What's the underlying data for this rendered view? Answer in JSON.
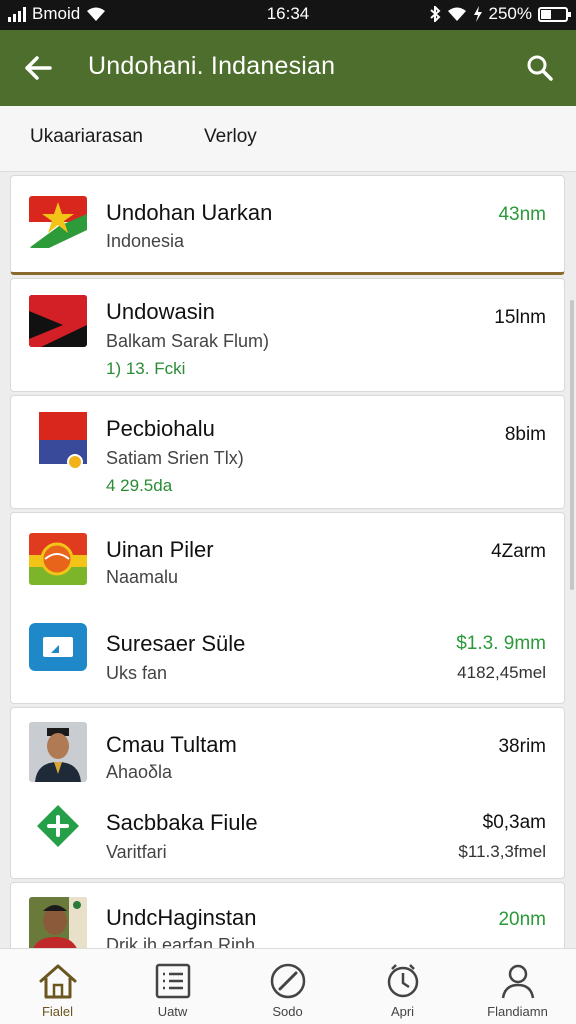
{
  "status_bar": {
    "carrier": "Bmoid",
    "time": "16:34",
    "battery": "250%"
  },
  "app_bar": {
    "title": "Undohani. Indanesian",
    "back_icon": "arrow-left-icon",
    "search_icon": "search-icon"
  },
  "tabs": [
    {
      "label": "Ukaariarasan"
    },
    {
      "label": "Verloy"
    }
  ],
  "items": [
    {
      "name": "Undohan Uarkan",
      "subtitle": "Indonesia",
      "value": "43nm",
      "icon": "flag-icon"
    },
    {
      "name": "Undowasin",
      "subtitle": "Balkam Sarak Flum)",
      "detail": "1) 13. Fcki",
      "value": "15lnm",
      "icon": "flag-icon"
    },
    {
      "name": "Pecbiohalu",
      "subtitle": "Satiam Srien Tlx)",
      "detail": "4 29.5da",
      "value": "8bim",
      "icon": "flag-icon"
    },
    {
      "name": "Uinan Piler",
      "subtitle": "Naamalu",
      "value": "4Zarm",
      "icon": "flag-icon"
    },
    {
      "name": "Suresaer Süle",
      "subtitle": "Uks fan",
      "value": "$1.3. 9mm",
      "value2": "4182,45mel",
      "icon": "chat-icon"
    },
    {
      "name": "Cmau Tultam",
      "subtitle": "Ahaoδla",
      "value": "38rim",
      "icon": "avatar-icon"
    },
    {
      "name": "Sacbbaka Fiule",
      "subtitle": "Varitfari",
      "value": "$0,3am",
      "value2": "$11.3,3fmel",
      "icon": "plus-icon"
    },
    {
      "name": "UndcHaginstan",
      "subtitle": "Drik ih earfan Rinh",
      "value": "20nm",
      "icon": "avatar-icon"
    }
  ],
  "bottom_nav": [
    {
      "label": "Fialel",
      "icon": "home-icon"
    },
    {
      "label": "Uatw",
      "icon": "list-icon"
    },
    {
      "label": "Sodo",
      "icon": "compass-icon"
    },
    {
      "label": "Apri",
      "icon": "clock-icon"
    },
    {
      "label": "Flandiamn",
      "icon": "profile-icon"
    }
  ],
  "colors": {
    "app_bar": "#4d6e2c",
    "accent_green": "#2a9a3a",
    "active_nav": "#6b5620",
    "divider_gold": "#8a6a2c"
  }
}
